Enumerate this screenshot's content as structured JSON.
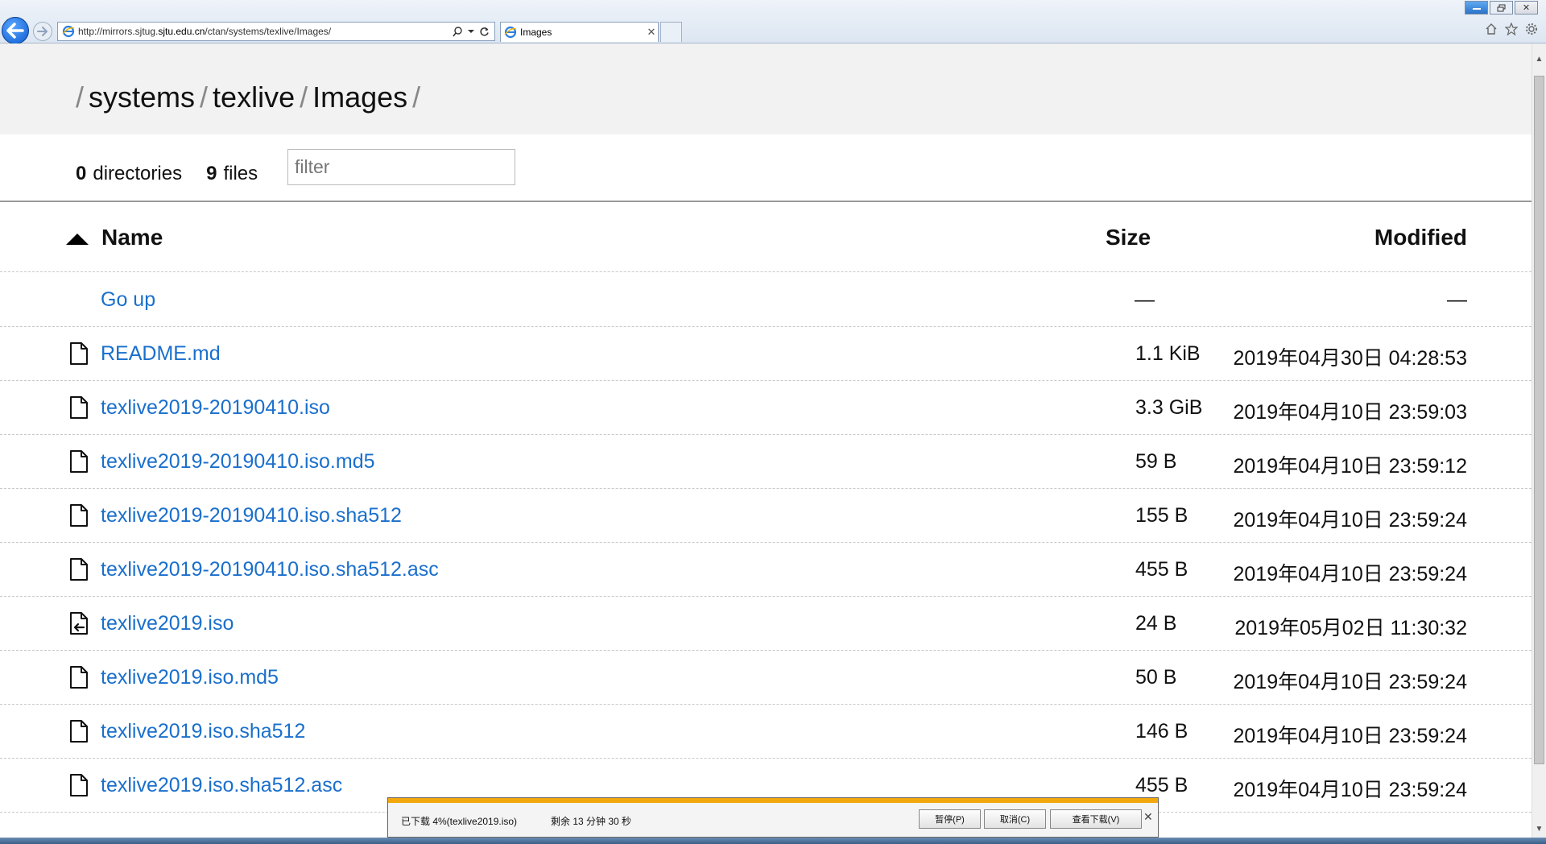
{
  "browser": {
    "url": "http://mirrors.sjtug.sjtu.edu.cn/ctan/systems/texlive/Images/",
    "url_prefix": "http://mirrors.sjtug.",
    "url_domain": "sjtu.edu.cn",
    "url_path": "/ctan/systems/texlive/Images/",
    "tab_title": "Images",
    "icons": [
      "back-arrow-icon",
      "forward-arrow-icon",
      "ie-page-icon",
      "search-icon",
      "dropdown-icon",
      "refresh-icon",
      "tab-close-icon",
      "home-icon",
      "favorites-star-icon",
      "settings-gear-icon"
    ],
    "window_buttons": {
      "minimize": "",
      "restore": "",
      "close": "✕"
    }
  },
  "breadcrumb": {
    "segments": [
      "systems",
      "texlive",
      "Images"
    ],
    "separator": "/"
  },
  "summary": {
    "directories_count": "0",
    "directories_label": "directories",
    "files_count": "9",
    "files_label": "files",
    "filter_placeholder": "filter"
  },
  "table": {
    "headers": {
      "name": "Name",
      "size": "Size",
      "modified": "Modified"
    },
    "sort": "name-ascending",
    "go_up": {
      "name": "Go up",
      "size": "—",
      "modified": "—"
    },
    "rows": [
      {
        "name": "README.md",
        "size": "1.1 KiB",
        "modified": "2019年04月30日 04:28:53",
        "icon": "file-icon"
      },
      {
        "name": "texlive2019-20190410.iso",
        "size": "3.3 GiB",
        "modified": "2019年04月10日 23:59:03",
        "icon": "file-icon"
      },
      {
        "name": "texlive2019-20190410.iso.md5",
        "size": "59 B",
        "modified": "2019年04月10日 23:59:12",
        "icon": "file-icon"
      },
      {
        "name": "texlive2019-20190410.iso.sha512",
        "size": "155 B",
        "modified": "2019年04月10日 23:59:24",
        "icon": "file-icon"
      },
      {
        "name": "texlive2019-20190410.iso.sha512.asc",
        "size": "455 B",
        "modified": "2019年04月10日 23:59:24",
        "icon": "file-icon"
      },
      {
        "name": "texlive2019.iso",
        "size": "24 B",
        "modified": "2019年05月02日 11:30:32",
        "icon": "symlink-file-icon"
      },
      {
        "name": "texlive2019.iso.md5",
        "size": "50 B",
        "modified": "2019年04月10日 23:59:24",
        "icon": "file-icon"
      },
      {
        "name": "texlive2019.iso.sha512",
        "size": "146 B",
        "modified": "2019年04月10日 23:59:24",
        "icon": "file-icon"
      },
      {
        "name": "texlive2019.iso.sha512.asc",
        "size": "455 B",
        "modified": "2019年04月10日 23:59:24",
        "icon": "file-icon"
      }
    ]
  },
  "download": {
    "status": "已下载 4%(texlive2019.iso)",
    "progress_percent": 4,
    "remaining": "剩余  13 分钟 30 秒",
    "pause_label": "暂停(P)",
    "cancel_label": "取消(C)",
    "view_label": "查看下载(V)",
    "close_label": "✕"
  },
  "colors": {
    "link": "#1a6fcc",
    "header_bg": "#f2f2f2",
    "download_progress": "#f2a80c"
  }
}
